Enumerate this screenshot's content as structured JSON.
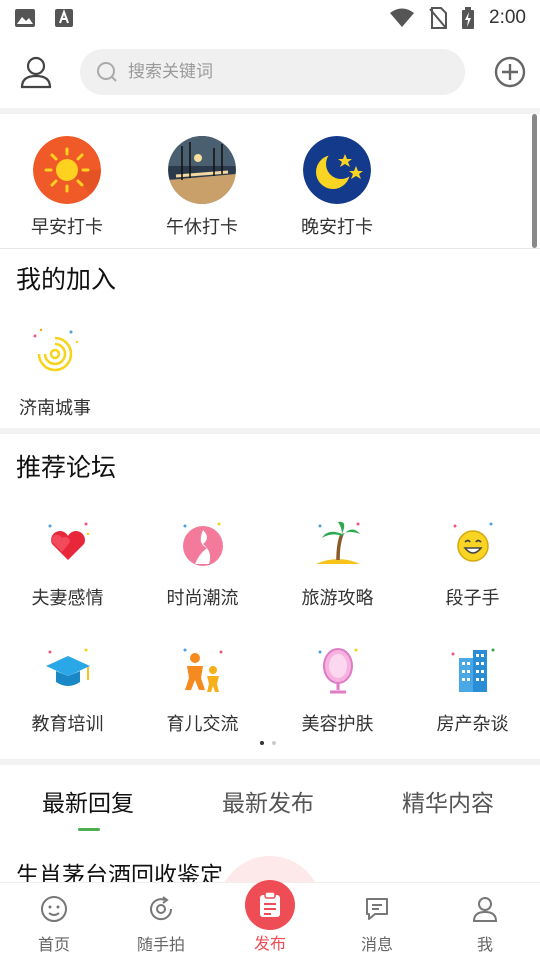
{
  "status_bar": {
    "time": "2:00"
  },
  "header": {
    "search_placeholder": "搜索关键词"
  },
  "punch_cards": [
    {
      "label": "早安打卡",
      "icon": "sun-icon"
    },
    {
      "label": "午休打卡",
      "icon": "night-street-icon"
    },
    {
      "label": "晚安打卡",
      "icon": "moon-stars-icon"
    }
  ],
  "joined": {
    "title": "我的加入",
    "items": [
      {
        "label": "济南城事",
        "icon": "spiral-icon"
      }
    ]
  },
  "recommended": {
    "title": "推荐论坛",
    "items": [
      {
        "label": "夫妻感情",
        "icon": "hearts-icon"
      },
      {
        "label": "时尚潮流",
        "icon": "fashion-icon"
      },
      {
        "label": "旅游攻略",
        "icon": "palm-tree-icon"
      },
      {
        "label": "段子手",
        "icon": "laughing-face-icon"
      },
      {
        "label": "教育培训",
        "icon": "graduation-cap-icon"
      },
      {
        "label": "育儿交流",
        "icon": "parent-child-icon"
      },
      {
        "label": "美容护肤",
        "icon": "mirror-icon"
      },
      {
        "label": "房产杂谈",
        "icon": "buildings-icon"
      }
    ]
  },
  "tabs": [
    {
      "label": "最新回复",
      "active": true
    },
    {
      "label": "最新发布",
      "active": false
    },
    {
      "label": "精华内容",
      "active": false
    }
  ],
  "first_post": {
    "title": "生肖茅台酒回收鉴定"
  },
  "bottom_nav": [
    {
      "label": "首页",
      "icon": "home-face-icon"
    },
    {
      "label": "随手拍",
      "icon": "camera-refresh-icon"
    },
    {
      "label": "发布",
      "icon": "clipboard-icon"
    },
    {
      "label": "消息",
      "icon": "message-icon"
    },
    {
      "label": "我",
      "icon": "person-icon"
    }
  ],
  "colors": {
    "accent_green": "#4caf50",
    "publish_red": "#ef4d55",
    "publish_bg": "#fde8ea"
  }
}
